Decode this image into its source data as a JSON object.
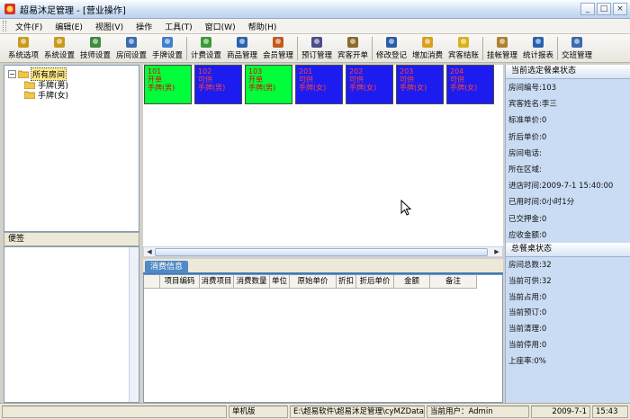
{
  "window": {
    "title": "超易沐足管理 - [营业操作]",
    "controls": [
      "_",
      "□",
      "×"
    ]
  },
  "menu": [
    "文件(F)",
    "编辑(E)",
    "视图(V)",
    "操作",
    "工具(T)",
    "窗口(W)",
    "帮助(H)"
  ],
  "toolbar": [
    {
      "label": "系统选项",
      "icon": "key-icon",
      "color": "#c99a1c"
    },
    {
      "label": "系统设置",
      "icon": "key-icon",
      "color": "#c99a1c"
    },
    {
      "label": "技师设置",
      "icon": "user-icon",
      "color": "#3e8a3e"
    },
    {
      "label": "房间设置",
      "icon": "building-icon",
      "color": "#3b6bb3"
    },
    {
      "label": "手牌设置",
      "icon": "tag-icon",
      "color": "#3f7fd0"
    },
    {
      "label": "计费设置",
      "icon": "money-icon",
      "color": "#3a9a3a"
    },
    {
      "label": "商品管理",
      "icon": "goods-icon",
      "color": "#2a62b0"
    },
    {
      "label": "会员管理",
      "icon": "member-icon",
      "color": "#c45a1c"
    },
    {
      "label": "预订管理",
      "icon": "phone-icon",
      "color": "#4c4c8a"
    },
    {
      "label": "宾客开单",
      "icon": "box-icon",
      "color": "#8c6a2a"
    },
    {
      "label": "修改登记",
      "icon": "edit-user-icon",
      "color": "#2a5ca8"
    },
    {
      "label": "增加消费",
      "icon": "add-icon",
      "color": "#d8a11a"
    },
    {
      "label": "宾客结账",
      "icon": "coin-icon",
      "color": "#d8b21a"
    },
    {
      "label": "挂帐管理",
      "icon": "bag-icon",
      "color": "#b08030"
    },
    {
      "label": "统计报表",
      "icon": "chart-icon",
      "color": "#2a62b0"
    },
    {
      "label": "交班管理",
      "icon": "group-icon",
      "color": "#3a6ab0"
    }
  ],
  "tree": {
    "root": "所有房间",
    "children": [
      "手牌(男)",
      "手牌(女)"
    ]
  },
  "note_panel": {
    "title": "便签"
  },
  "rooms": [
    {
      "number": "101",
      "status": "开单",
      "type": "手牌(男)",
      "color": "green"
    },
    {
      "number": "102",
      "status": "可供",
      "type": "手牌(男)",
      "color": "blue"
    },
    {
      "number": "103",
      "status": "开单",
      "type": "手牌(男)",
      "color": "green"
    },
    {
      "number": "201",
      "status": "可供",
      "type": "手牌(女)",
      "color": "blue"
    },
    {
      "number": "202",
      "status": "可供",
      "type": "手牌(女)",
      "color": "blue"
    },
    {
      "number": "203",
      "status": "可供",
      "type": "手牌(女)",
      "color": "blue"
    },
    {
      "number": "204",
      "status": "可供",
      "type": "手牌(女)",
      "color": "blue"
    }
  ],
  "consumption": {
    "tab": "消费信息",
    "columns": [
      "项目编码",
      "消费项目",
      "消费数量",
      "单位",
      "原始单价",
      "折扣",
      "折后单价",
      "金额",
      "备注"
    ]
  },
  "room_status": {
    "title": "当前选定餐桌状态",
    "rows": [
      "房间编号:103",
      "宾客姓名:李三",
      "标准单价:0",
      "折后单价:0",
      "房间电话:",
      "所在区域:",
      "进店时间:2009-7-1 15:40:00",
      "已用时间:0小时1分",
      "已交押金:0",
      "应收金额:0"
    ]
  },
  "overall_status": {
    "title": "总餐桌状态",
    "rows": [
      "房间总数:32",
      "当前可供:32",
      "当前占用:0",
      "当前预订:0",
      "当前清理:0",
      "当前停用:0",
      "上座率:0%"
    ]
  },
  "statusbar": {
    "mode": "单机版",
    "path": "E:\\超易软件\\超易沐足管理\\cyMZData.sys",
    "user": "当前用户：Admin",
    "date": "2009-7-1",
    "time": "15:43"
  }
}
